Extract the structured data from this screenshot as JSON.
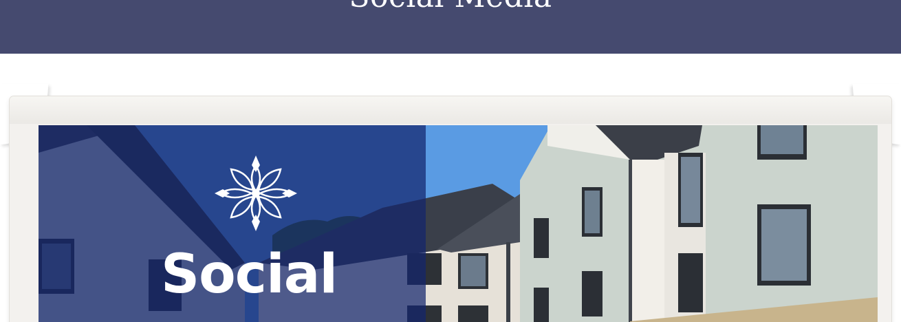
{
  "header": {
    "title": "Social Media"
  },
  "banner": {
    "word": "Social"
  },
  "icons": {
    "logo": "flower-logo-icon"
  },
  "colors": {
    "header_bg": "#454a6f",
    "brand_overlay": "#14266e",
    "sky": "#5a9be3",
    "cladding": "#c9d3cc",
    "roof": "#3a3f4a"
  }
}
